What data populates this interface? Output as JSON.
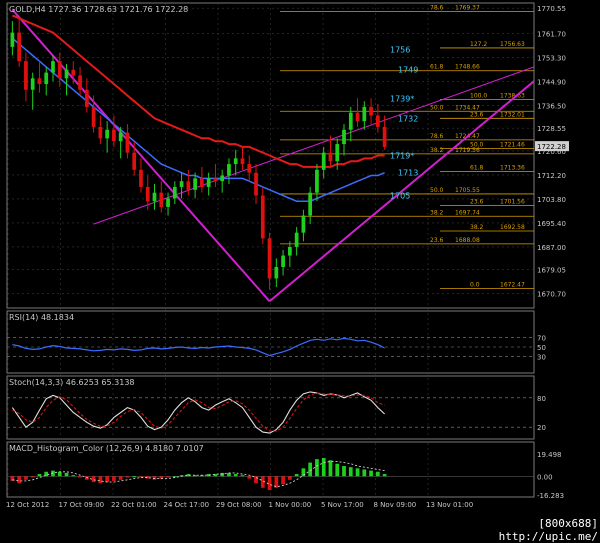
{
  "window": {
    "title": "GOLD,H4  1727.36 1728.63 1721.76 1722.28",
    "footer_text": "[800x688] http://upic.me/"
  },
  "colors": {
    "bg": "#000000",
    "grid": "#3a3a3a",
    "frame": "#8a8a8a",
    "bull": "#1fd11f",
    "bear": "#e01010",
    "fib": "#d8a000",
    "channel": "#d020d0",
    "ma_red": "#e21a1a",
    "ma_blue": "#3a6dff",
    "cyan_text": "#40c8ff",
    "rsi": "#3a6dff",
    "stoch_main": "#e0e0e0",
    "stoch_signal": "#e01010"
  },
  "chart_data": [
    {
      "type": "candlestick",
      "title": "GOLD,H4  1727.36 1728.63 1721.76 1722.28",
      "ylim": [
        1666,
        1772
      ],
      "y_ticks": [
        1770.55,
        1761.7,
        1753.3,
        1744.9,
        1736.5,
        1728.55,
        1720.6,
        1712.2,
        1703.8,
        1695.4,
        1687.0,
        1679.05,
        1670.7
      ],
      "y_tick_labels": [
        "1770.55",
        "1761.70",
        "1753.30",
        "1744.90",
        "1736.50",
        "1728.55",
        "1720.60",
        "1712.20",
        "1703.80",
        "1695.40",
        "1687.00",
        "1679.05",
        "1670.70"
      ],
      "last_price_label": "1722.28",
      "x_ticks": [
        "12 Oct 2012",
        "17 Oct 09:00",
        "22 Oct 01:00",
        "24 Oct 17:00",
        "29 Oct 08:00",
        "1 Nov 00:00",
        "5 Nov 17:00",
        "8 Nov 09:00",
        "13 Nov 01:00"
      ],
      "candles": [
        [
          1757,
          1766,
          1754,
          1762
        ],
        [
          1762,
          1767,
          1750,
          1752
        ],
        [
          1752,
          1755,
          1738,
          1742
        ],
        [
          1742,
          1748,
          1735,
          1746
        ],
        [
          1746,
          1752,
          1741,
          1744
        ],
        [
          1744,
          1750,
          1740,
          1748
        ],
        [
          1748,
          1754,
          1745,
          1752
        ],
        [
          1752,
          1755,
          1743,
          1746
        ],
        [
          1746,
          1751,
          1740,
          1749
        ],
        [
          1749,
          1752,
          1744,
          1747
        ],
        [
          1747,
          1750,
          1740,
          1742
        ],
        [
          1742,
          1746,
          1734,
          1736
        ],
        [
          1736,
          1740,
          1727,
          1729
        ],
        [
          1729,
          1733,
          1723,
          1725
        ],
        [
          1725,
          1731,
          1720,
          1728
        ],
        [
          1728,
          1733,
          1722,
          1724
        ],
        [
          1724,
          1729,
          1718,
          1727
        ],
        [
          1727,
          1730,
          1718,
          1720
        ],
        [
          1720,
          1724,
          1712,
          1714
        ],
        [
          1714,
          1718,
          1706,
          1708
        ],
        [
          1708,
          1712,
          1700,
          1703
        ],
        [
          1703,
          1709,
          1700,
          1706
        ],
        [
          1706,
          1710,
          1699,
          1701
        ],
        [
          1701,
          1706,
          1698,
          1704
        ],
        [
          1704,
          1710,
          1702,
          1708
        ],
        [
          1708,
          1713,
          1704,
          1710
        ],
        [
          1710,
          1714,
          1705,
          1707
        ],
        [
          1707,
          1713,
          1704,
          1711
        ],
        [
          1711,
          1715,
          1706,
          1708
        ],
        [
          1708,
          1713,
          1705,
          1711
        ],
        [
          1711,
          1716,
          1708,
          1710
        ],
        [
          1710,
          1714,
          1706,
          1712
        ],
        [
          1712,
          1718,
          1709,
          1716
        ],
        [
          1716,
          1721,
          1712,
          1718
        ],
        [
          1718,
          1722,
          1714,
          1716
        ],
        [
          1716,
          1719,
          1710,
          1713
        ],
        [
          1713,
          1716,
          1702,
          1705
        ],
        [
          1705,
          1708,
          1688,
          1690
        ],
        [
          1690,
          1692,
          1672,
          1676
        ],
        [
          1676,
          1683,
          1673,
          1680
        ],
        [
          1680,
          1686,
          1677,
          1684
        ],
        [
          1684,
          1689,
          1680,
          1687
        ],
        [
          1687,
          1694,
          1684,
          1692
        ],
        [
          1692,
          1700,
          1689,
          1698
        ],
        [
          1698,
          1708,
          1695,
          1706
        ],
        [
          1706,
          1716,
          1703,
          1714
        ],
        [
          1714,
          1722,
          1711,
          1720
        ],
        [
          1720,
          1726,
          1715,
          1717
        ],
        [
          1717,
          1725,
          1714,
          1723
        ],
        [
          1723,
          1730,
          1719,
          1728
        ],
        [
          1728,
          1736,
          1724,
          1734
        ],
        [
          1734,
          1739,
          1729,
          1731
        ],
        [
          1731,
          1738,
          1728,
          1736
        ],
        [
          1736,
          1739,
          1730,
          1733
        ],
        [
          1733,
          1737,
          1727,
          1729
        ],
        [
          1729,
          1733,
          1721,
          1722
        ]
      ],
      "moving_averages": [
        {
          "name": "red",
          "values": [
            1768,
            1767,
            1766,
            1765,
            1764,
            1763,
            1762,
            1760,
            1758,
            1756,
            1754,
            1752,
            1750,
            1748,
            1746,
            1744,
            1742,
            1740,
            1738,
            1736,
            1734,
            1732,
            1731,
            1730,
            1729,
            1728,
            1727,
            1726,
            1725,
            1725,
            1724,
            1724,
            1723,
            1723,
            1722,
            1722,
            1721,
            1720,
            1719,
            1718,
            1717,
            1716,
            1716,
            1715,
            1715,
            1715,
            1715,
            1715,
            1716,
            1716,
            1717,
            1717,
            1718,
            1718,
            1719,
            1719
          ]
        },
        {
          "name": "blue",
          "values": [
            1760,
            1758,
            1756,
            1754,
            1752,
            1750,
            1748,
            1746,
            1744,
            1742,
            1740,
            1738,
            1736,
            1734,
            1732,
            1730,
            1728,
            1726,
            1724,
            1722,
            1720,
            1718,
            1716,
            1715,
            1714,
            1713,
            1712,
            1712,
            1711,
            1711,
            1711,
            1711,
            1711,
            1711,
            1711,
            1710,
            1709,
            1708,
            1707,
            1706,
            1705,
            1704,
            1703,
            1703,
            1703,
            1704,
            1705,
            1706,
            1707,
            1708,
            1709,
            1710,
            1711,
            1712,
            1712,
            1713
          ]
        }
      ],
      "fib_levels": [
        {
          "ratio": "78.6",
          "price": 1769.37
        },
        {
          "ratio": "127.2",
          "price": 1756.63
        },
        {
          "ratio": "61.8",
          "price": 1748.66
        },
        {
          "ratio": "100.0",
          "price": 1738.63
        },
        {
          "ratio": "50.0",
          "price": 1734.47
        },
        {
          "ratio": "23.6",
          "price": 1732.01
        },
        {
          "ratio": "78.6",
          "price": 1724.47
        },
        {
          "ratio": "50.0",
          "price": 1721.46
        },
        {
          "ratio": "38.2",
          "price": 1719.56
        },
        {
          "ratio": "61.8",
          "price": 1713.36
        },
        {
          "ratio": "50.0",
          "price": 1705.55
        },
        {
          "ratio": "23.6",
          "price": 1701.56
        },
        {
          "ratio": "38.2",
          "price": 1697.74
        },
        {
          "ratio": "38.2",
          "price": 1692.58
        },
        {
          "ratio": "23.6",
          "price": 1688.08
        },
        {
          "ratio": "0.0",
          "price": 1672.47
        }
      ],
      "annotations": [
        {
          "text": "1756",
          "price": 1756
        },
        {
          "text": "1749",
          "price": 1749
        },
        {
          "text": "1739*",
          "price": 1739
        },
        {
          "text": "1732",
          "price": 1732
        },
        {
          "text": "1719*",
          "price": 1719
        },
        {
          "text": "1713",
          "price": 1713
        },
        {
          "text": "1705",
          "price": 1705
        }
      ]
    },
    {
      "type": "line",
      "title": "RSI(14) 48.1834",
      "ylim": [
        0,
        100
      ],
      "levels": [
        70,
        50,
        30
      ],
      "y_tick_labels": [
        "70",
        "50",
        "30"
      ],
      "values": [
        55,
        52,
        47,
        45,
        46,
        50,
        53,
        51,
        48,
        47,
        46,
        44,
        42,
        43,
        45,
        44,
        46,
        45,
        43,
        44,
        47,
        48,
        46,
        47,
        49,
        50,
        48,
        47,
        49,
        48,
        50,
        51,
        52,
        50,
        49,
        47,
        44,
        38,
        32,
        36,
        40,
        45,
        52,
        58,
        64,
        66,
        64,
        67,
        65,
        68,
        66,
        63,
        64,
        60,
        55,
        48
      ]
    },
    {
      "type": "line",
      "title": "Stoch(14,3,3) 46.6253 65.3138",
      "ylim": [
        0,
        100
      ],
      "levels": [
        80,
        20
      ],
      "y_tick_labels": [
        "80",
        "20"
      ],
      "series": [
        {
          "name": "main",
          "values": [
            60,
            40,
            20,
            30,
            55,
            78,
            85,
            80,
            65,
            50,
            40,
            30,
            22,
            18,
            25,
            40,
            50,
            60,
            55,
            40,
            22,
            15,
            20,
            35,
            55,
            70,
            80,
            72,
            60,
            55,
            65,
            72,
            78,
            70,
            60,
            40,
            20,
            10,
            8,
            15,
            30,
            55,
            75,
            88,
            92,
            90,
            85,
            88,
            86,
            80,
            85,
            90,
            82,
            75,
            60,
            47
          ]
        },
        {
          "name": "signal",
          "values": [
            55,
            48,
            35,
            30,
            40,
            60,
            75,
            82,
            76,
            62,
            48,
            36,
            28,
            22,
            22,
            30,
            42,
            52,
            56,
            50,
            36,
            22,
            18,
            25,
            40,
            55,
            70,
            76,
            70,
            60,
            58,
            64,
            72,
            74,
            68,
            55,
            38,
            22,
            12,
            12,
            20,
            38,
            58,
            76,
            86,
            90,
            88,
            87,
            86,
            84,
            84,
            86,
            85,
            80,
            70,
            65
          ]
        }
      ]
    },
    {
      "type": "bar",
      "title": "MACD_Histogram_Color (12,26,9) 4.8180 7.0107",
      "ylim": [
        -16.283,
        19.498
      ],
      "y_tick_labels": [
        "19.498",
        "0.00",
        "-16.283"
      ],
      "values": [
        -4,
        -6,
        -3,
        -1,
        2,
        4,
        5,
        4,
        3,
        1,
        -1,
        -3,
        -5,
        -6,
        -5,
        -4,
        -3,
        -1,
        0,
        -1,
        -2,
        -3,
        -2,
        -1,
        0,
        1,
        2,
        1,
        1,
        2,
        2,
        3,
        3,
        2,
        1,
        -2,
        -6,
        -10,
        -12,
        -10,
        -7,
        -3,
        2,
        7,
        12,
        15,
        16,
        14,
        11,
        9,
        8,
        7,
        6,
        5,
        4,
        2
      ],
      "signal": [
        -3,
        -4,
        -4,
        -3,
        -1,
        1,
        3,
        4,
        4,
        3,
        1,
        -1,
        -3,
        -4,
        -5,
        -5,
        -4,
        -3,
        -2,
        -1,
        -1,
        -2,
        -2,
        -2,
        -1,
        0,
        1,
        1,
        1,
        1,
        2,
        2,
        3,
        3,
        2,
        1,
        -1,
        -4,
        -7,
        -9,
        -8,
        -6,
        -3,
        1,
        5,
        9,
        12,
        13,
        13,
        12,
        11,
        9,
        8,
        7,
        6,
        5
      ]
    }
  ]
}
